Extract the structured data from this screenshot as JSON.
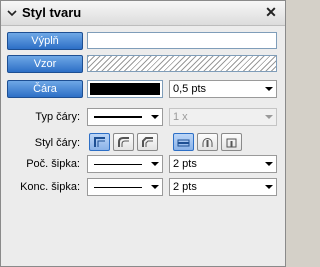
{
  "title": "Styl tvaru",
  "buttons": {
    "fill": "Výplň",
    "pattern": "Vzor",
    "line": "Čára"
  },
  "line_width": "0,5 pts",
  "line_type_label": "Typ čáry:",
  "line_scale": "1 x",
  "line_style_label": "Styl čáry:",
  "start_arrow_label": "Poč. šipka:",
  "start_arrow_size": "2 pts",
  "end_arrow_label": "Konc. šipka:",
  "end_arrow_size": "2 pts",
  "colors": {
    "accent": "#2d6fc6",
    "line_color": "#000000",
    "fill_color": "#ffffff"
  }
}
